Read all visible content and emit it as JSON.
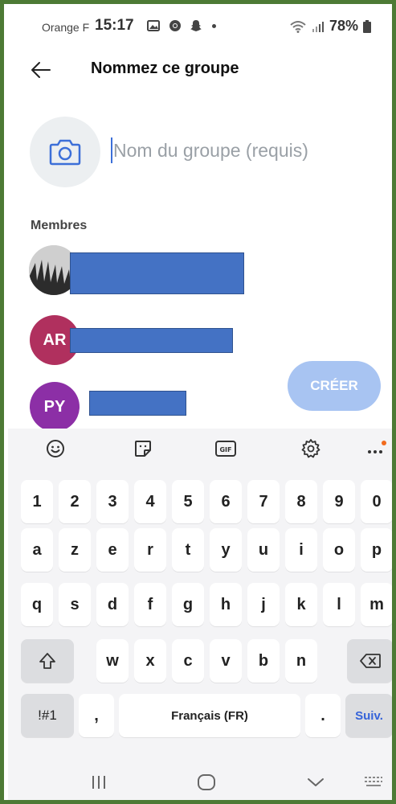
{
  "status_bar": {
    "carrier": "Orange F",
    "time": "15:17",
    "battery": "78%"
  },
  "header": {
    "title": "Nommez ce groupe"
  },
  "group_name": {
    "value": "",
    "placeholder": "Nom du groupe (requis)"
  },
  "members": {
    "label": "Membres",
    "items": [
      {
        "initials": "",
        "name_redacted": true
      },
      {
        "initials": "AR",
        "name_redacted": true
      },
      {
        "initials": "PY",
        "name_redacted": true
      }
    ]
  },
  "create_button": {
    "label": "CRÉER"
  },
  "keyboard": {
    "toolbar": [
      "emoji-icon",
      "sticker-icon",
      "gif-icon",
      "settings-icon",
      "more-icon"
    ],
    "row_numbers": [
      "1",
      "2",
      "3",
      "4",
      "5",
      "6",
      "7",
      "8",
      "9",
      "0"
    ],
    "row_1": [
      "a",
      "z",
      "e",
      "r",
      "t",
      "y",
      "u",
      "i",
      "o",
      "p"
    ],
    "row_2": [
      "q",
      "s",
      "d",
      "f",
      "g",
      "h",
      "j",
      "k",
      "l",
      "m"
    ],
    "row_3": [
      "w",
      "x",
      "c",
      "v",
      "b",
      "n"
    ],
    "symbols_key": "!#1",
    "comma_key": ",",
    "space_label": "Français (FR)",
    "period_key": ".",
    "next_key": "Suiv."
  },
  "colors": {
    "frame": "#4d7a35",
    "accent": "#3c6fd8",
    "create_button": "#a8c4f2",
    "redaction": "#4472c4",
    "avatar_ar": "#b0305e",
    "avatar_py": "#8c2fa6"
  }
}
